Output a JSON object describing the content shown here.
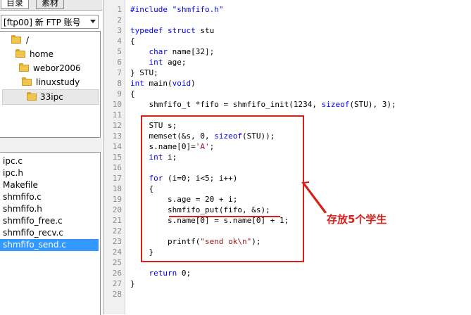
{
  "left_panel": {
    "tabs": [
      {
        "label": "目录"
      },
      {
        "label": "素材"
      }
    ],
    "account_select": {
      "value": "[ftp00] 新 FTP 账号"
    },
    "tree": [
      {
        "label": "/"
      },
      {
        "label": "home"
      },
      {
        "label": "webor2006"
      },
      {
        "label": "linuxstudy"
      },
      {
        "label": "33ipc",
        "selected": true
      }
    ],
    "files": [
      {
        "name": "ipc.c"
      },
      {
        "name": "ipc.h"
      },
      {
        "name": "Makefile"
      },
      {
        "name": "shmfifo.c"
      },
      {
        "name": "shmfifo.h"
      },
      {
        "name": "shmfifo_free.c"
      },
      {
        "name": "shmfifo_recv.c"
      },
      {
        "name": "shmfifo_send.c",
        "selected": true
      }
    ]
  },
  "editor": {
    "line_numbers": [
      "1",
      "2",
      "3",
      "4",
      "5",
      "6",
      "7",
      "8",
      "9",
      "10",
      "11",
      "12",
      "13",
      "14",
      "15",
      "16",
      "17",
      "18",
      "19",
      "20",
      "21",
      "22",
      "23",
      "24",
      "25",
      "26",
      "27",
      "28"
    ],
    "lines": [
      "#include \"shmfifo.h\"",
      "",
      "typedef struct stu",
      "{",
      "    char name[32];",
      "    int age;",
      "} STU;",
      "int main(void)",
      "{",
      "    shmfifo_t *fifo = shmfifo_init(1234, sizeof(STU), 3);",
      "",
      "    STU s;",
      "    memset(&s, 0, sizeof(STU));",
      "    s.name[0]='A';",
      "    int i;",
      "",
      "    for (i=0; i<5; i++)",
      "    {",
      "        s.age = 20 + i;",
      "        shmfifo_put(fifo, &s);",
      "        s.name[0] = s.name[0] + 1;",
      "",
      "        printf(\"send ok\\n\");",
      "    }",
      "",
      "    return 0;",
      "}",
      ""
    ]
  },
  "annotation": {
    "text": "存放5个学生",
    "color": "#d6201c"
  },
  "colors": {
    "keyword": "#0000ff",
    "string": "#a31515",
    "selection": "#3399ff"
  }
}
